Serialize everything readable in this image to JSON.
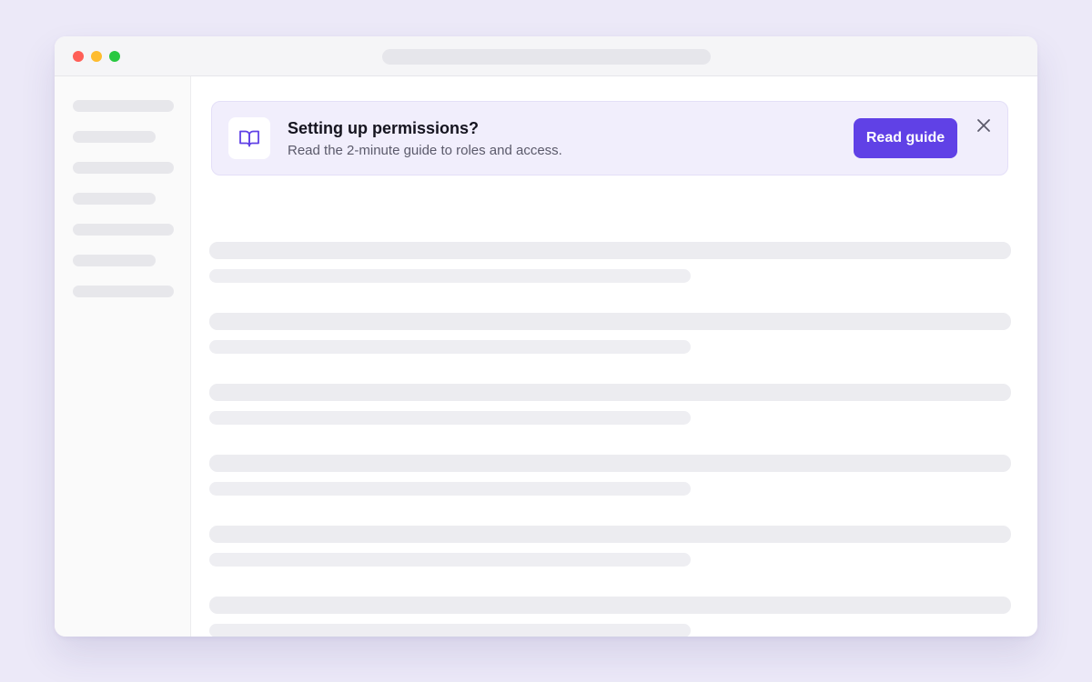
{
  "window": {
    "traffic_lights": [
      "close",
      "minimize",
      "zoom"
    ]
  },
  "sidebar": {
    "items": [
      {
        "kind": "placeholder"
      },
      {
        "kind": "placeholder"
      },
      {
        "kind": "placeholder"
      },
      {
        "kind": "placeholder"
      },
      {
        "kind": "placeholder"
      },
      {
        "kind": "placeholder"
      },
      {
        "kind": "placeholder"
      }
    ]
  },
  "banner": {
    "icon": "book-open-icon",
    "title": "Setting up permissions?",
    "description": "Read the 2-minute guide to roles and access.",
    "cta_label": "Read guide",
    "close_icon": "close-icon"
  },
  "content": {
    "skeleton_rows": 6
  },
  "colors": {
    "page_background": "#ECE9F8",
    "accent": "#6041E6",
    "banner_background": "#F1EEFC",
    "close_dot": "#FF5F57",
    "minimize_dot": "#FEBC2E",
    "zoom_dot": "#28C840"
  }
}
